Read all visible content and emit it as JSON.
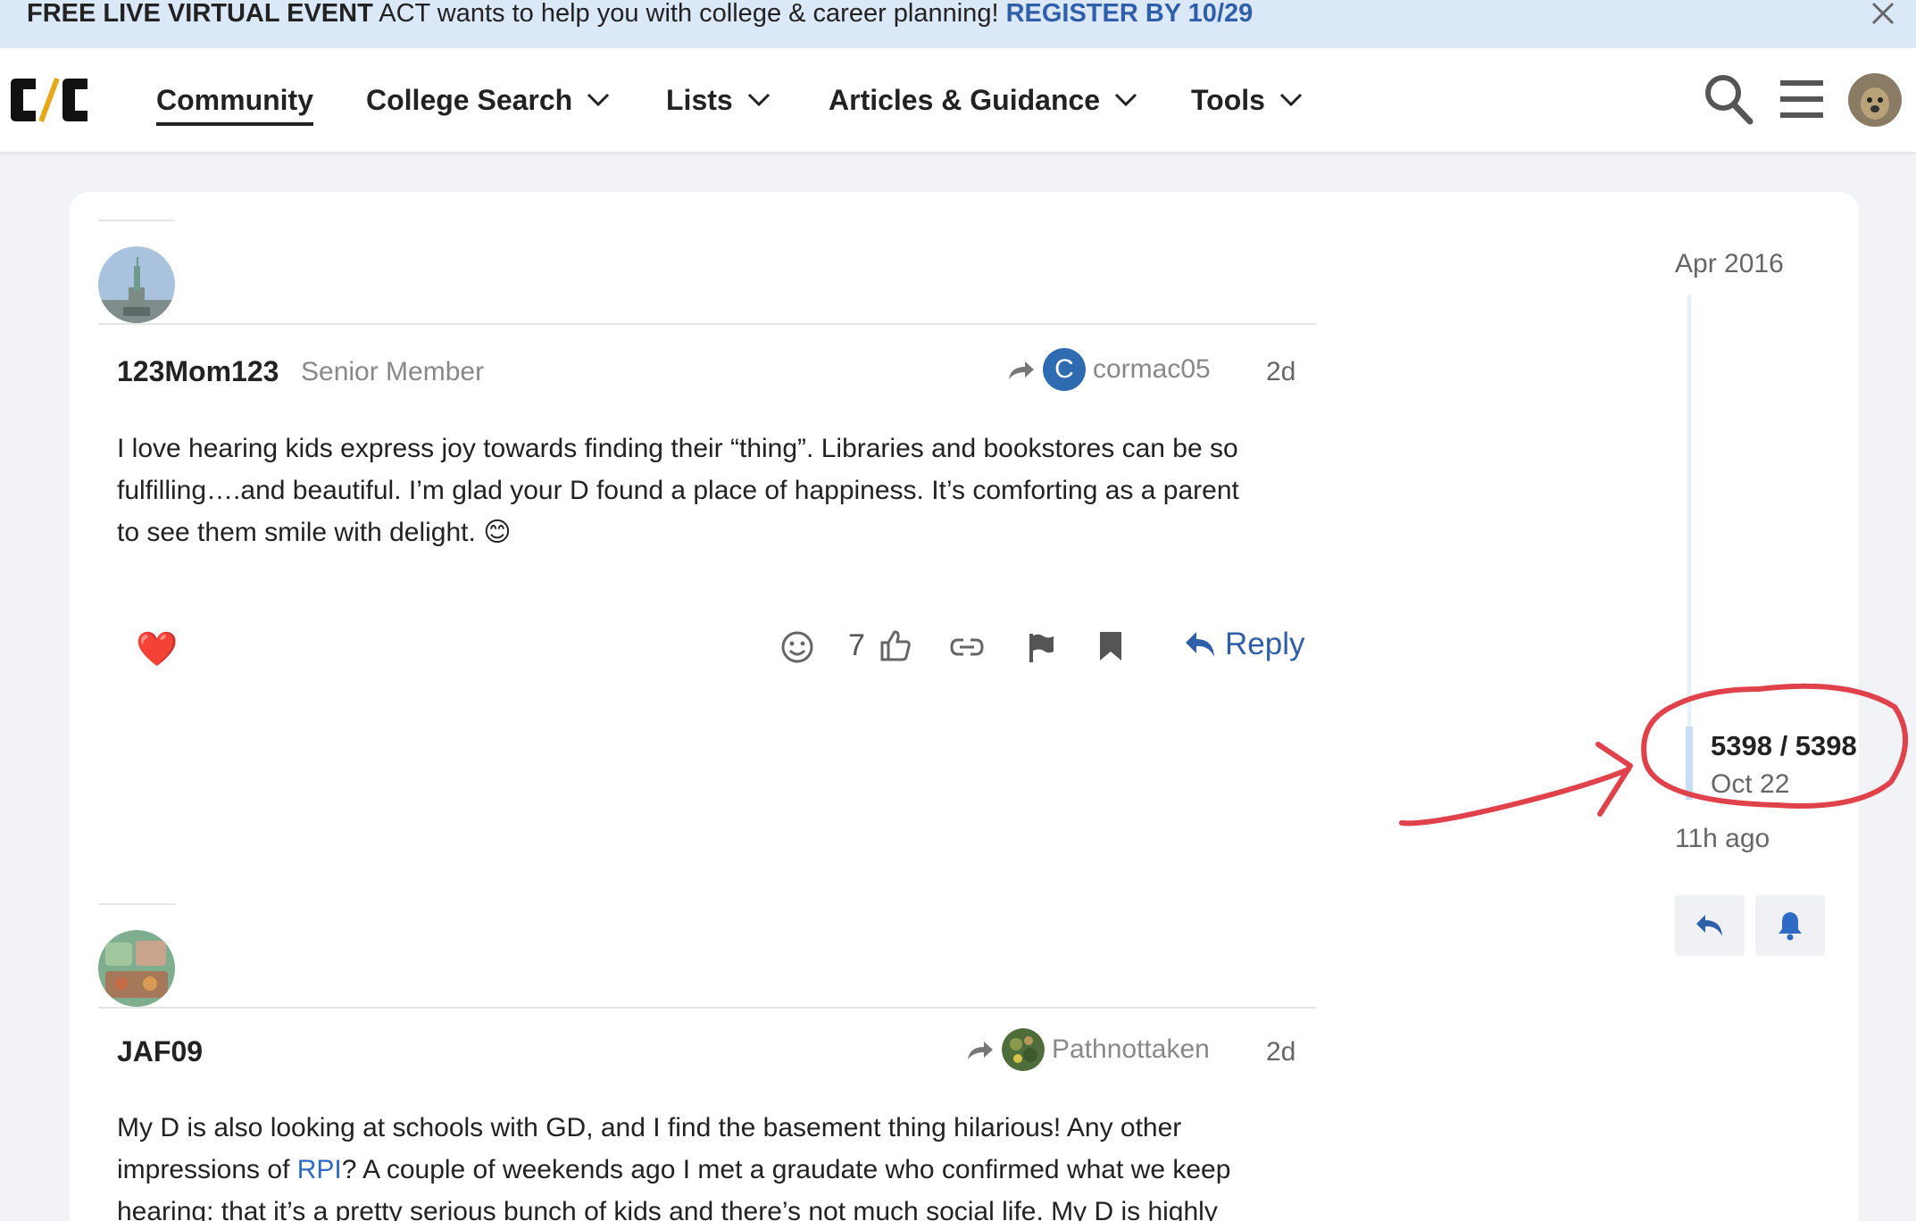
{
  "banner": {
    "event_label": "FREE LIVE VIRTUAL EVENT",
    "message": " ACT wants to help you with college & career planning! ",
    "cta": "REGISTER BY 10/29",
    "close_icon": "close-icon"
  },
  "header": {
    "logo_text": "C/C",
    "nav": [
      {
        "label": "Community",
        "active": true
      },
      {
        "label": "College Search",
        "dropdown": true
      },
      {
        "label": "Lists",
        "dropdown": true
      },
      {
        "label": "Articles & Guidance",
        "dropdown": true
      },
      {
        "label": "Tools",
        "dropdown": true
      }
    ],
    "icons": [
      "search-icon",
      "hamburger-menu-icon",
      "user-avatar"
    ]
  },
  "posts": [
    {
      "username": "123Mom123",
      "user_title": "Senior Member",
      "reply_to_initial": "C",
      "reply_to_user": "cormac05",
      "date": "2d",
      "body_lines": [
        "I love hearing kids express joy towards finding their “thing”. Libraries and bookstores can be so",
        "fulfilling….and beautiful. I’m glad your D found a place of happiness. It’s comforting as a parent",
        "to see them smile with delight. "
      ],
      "emoji": "😊",
      "reaction_emoji": "❤️",
      "like_count": "7",
      "reply_label": "Reply"
    },
    {
      "username": "JAF09",
      "reply_to_user": "Pathnottaken",
      "date": "2d",
      "body_line1": "My D is also looking at schools with GD, and I find the basement thing hilarious! Any other",
      "body_line2_pre": "impressions of ",
      "body_link": "RPI",
      "body_line2_post": "? A couple of weekends ago I met a graudate who confirmed what we keep",
      "body_line3": "hearing: that it’s a pretty serious bunch of kids and there’s not much social life. My D is highly"
    }
  ],
  "timeline": {
    "start_date": "Apr 2016",
    "position": "5398 / 5398",
    "current_date": "Oct 22",
    "last_activity": "11h ago"
  },
  "colors": {
    "banner_bg": "#dbe8f8",
    "link": "#2f5fa8",
    "annotation": "#e0424b"
  }
}
